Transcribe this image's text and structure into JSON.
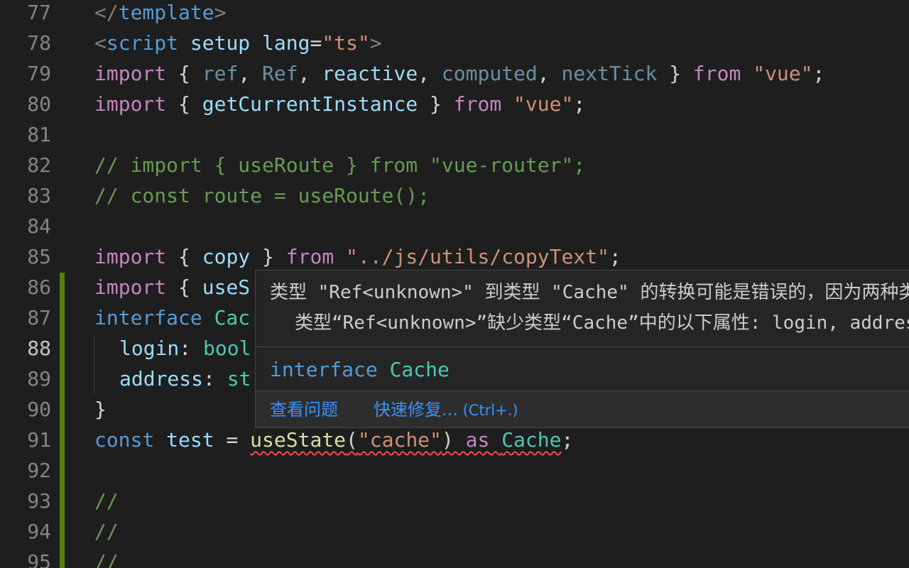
{
  "editor": {
    "line_numbers": [
      "77",
      "78",
      "79",
      "80",
      "81",
      "82",
      "83",
      "84",
      "85",
      "86",
      "87",
      "88",
      "89",
      "90",
      "91",
      "92",
      "93",
      "94",
      "95"
    ],
    "active_line": "88",
    "lines": {
      "l77": [
        "</",
        "template",
        ">"
      ],
      "l78": [
        "<",
        "script",
        " ",
        "setup",
        " ",
        "lang",
        "=",
        "\"ts\"",
        ">"
      ],
      "l79": [
        "import",
        " { ",
        "ref",
        ", ",
        "Ref",
        ", ",
        "reactive",
        ", ",
        "computed",
        ", ",
        "nextTick",
        " } ",
        "from",
        " ",
        "\"vue\"",
        ";"
      ],
      "l80": [
        "import",
        " { ",
        "getCurrentInstance",
        " } ",
        "from",
        " ",
        "\"vue\"",
        ";"
      ],
      "l82": "// import { useRoute } from \"vue-router\";",
      "l83": "// const route = useRoute();",
      "l85": [
        "import",
        " { ",
        "copy",
        " } ",
        "from",
        " ",
        "\"../js/utils/copyText\"",
        ";"
      ],
      "l86": [
        "import",
        " { ",
        "useS"
      ],
      "l87": [
        "interface",
        " ",
        "Cac"
      ],
      "l88": [
        "login",
        ": ",
        "bool"
      ],
      "l89": [
        "address",
        ": ",
        "st"
      ],
      "l90": "}",
      "l91": [
        "const",
        " ",
        "test",
        " = ",
        "useState",
        "(",
        "\"cache\"",
        ") ",
        "as",
        " ",
        "Cache",
        ";"
      ],
      "l93": "//",
      "l94": "//",
      "l95": "//"
    }
  },
  "hover": {
    "message_line1": "类型 \"Ref<unknown>\" 到类型 \"Cache\" 的转换可能是错误的，因为两种类型不能充分重叠。",
    "message_line2": "类型“Ref<unknown>”缺少类型“Cache”中的以下属性: login, address",
    "signature_keyword": "interface",
    "signature_name": "Cache",
    "action_view_problem": "查看问题",
    "action_quick_fix": "快速修复...",
    "action_quick_fix_shortcut": " (Ctrl+.)"
  },
  "colors": {
    "background": "#1e1e1e",
    "git_modified_bar": "#587c0c",
    "error_squiggle": "#f14c4c",
    "link": "#3794ff"
  }
}
